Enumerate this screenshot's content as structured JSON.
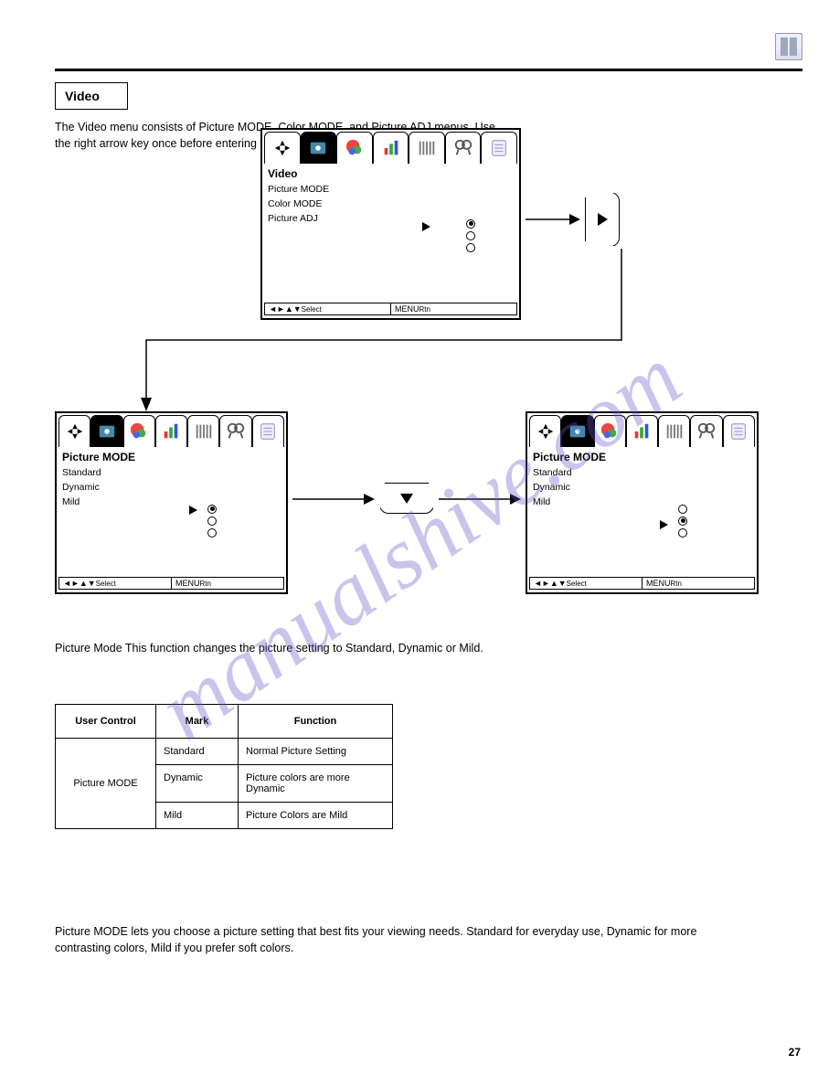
{
  "header": {
    "section_title": "Video"
  },
  "intro_text": "The Video menu consists of Picture MODE, Color MODE, and Picture ADJ menus. Use the right arrow key once before entering the lower level menus.",
  "screens": {
    "main": {
      "title": "Video",
      "items": [
        "Picture MODE",
        "Color MODE",
        "Picture ADJ"
      ],
      "footer_left": "Select",
      "footer_right": "Rtn",
      "selected_radio": 0
    },
    "sub_left": {
      "title": "Picture MODE",
      "items": [
        "Standard",
        "Dynamic",
        "Mild"
      ],
      "footer_left": "Select",
      "footer_right": "Rtn",
      "selected_radio": 0
    },
    "sub_right": {
      "title": "Picture MODE",
      "items": [
        "Standard",
        "Dynamic",
        "Mild"
      ],
      "footer_left": "Select",
      "footer_right": "Rtn",
      "selected_radio": 1
    }
  },
  "between_para": "Picture Mode This function changes the picture setting to Standard, Dynamic or Mild.",
  "table": {
    "header": [
      "User Control",
      "Mark",
      "Function"
    ],
    "rows": [
      {
        "control": "Picture MODE",
        "rowspan": 3,
        "marks": [
          "Standard",
          "Dynamic",
          "Mild"
        ],
        "funcs": [
          "Normal Picture Setting",
          "Picture colors are more Dynamic",
          "Picture Colors are Mild"
        ]
      }
    ]
  },
  "bottom_para": "Picture MODE lets you choose a picture setting that best fits your viewing needs. Standard for everyday use, Dynamic for more contrasting colors, Mild if you prefer soft colors.",
  "page_number": "27",
  "tabs": [
    "move",
    "video",
    "color",
    "levels",
    "tuning",
    "sound",
    "setup"
  ]
}
